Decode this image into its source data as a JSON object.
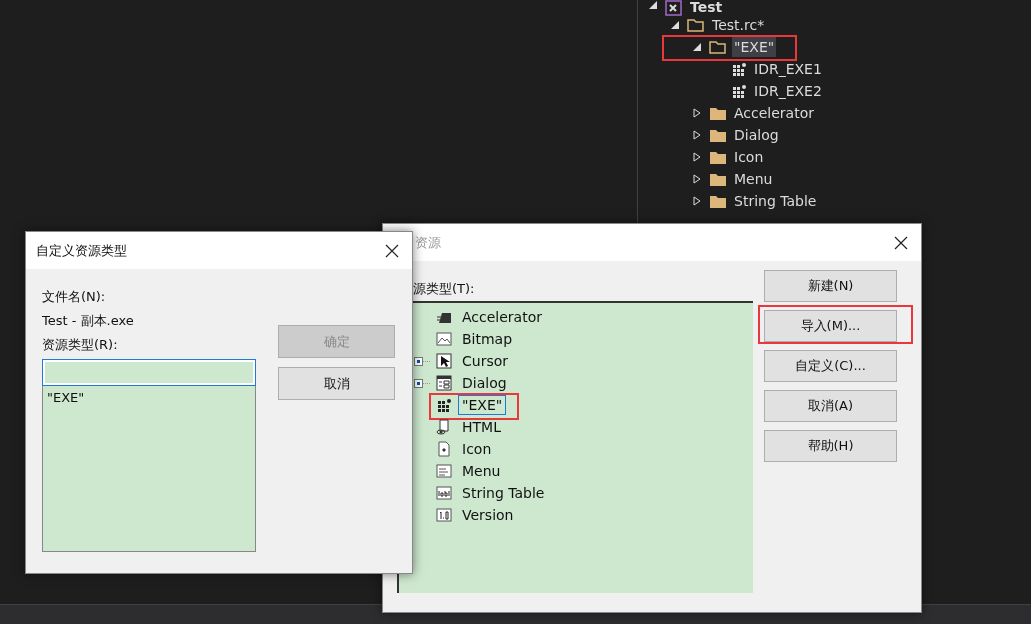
{
  "solution_tree": [
    {
      "label": "Test",
      "kind": "project",
      "expanded": true,
      "selected": false,
      "highlighted": false,
      "children": [
        {
          "label": "Test.rc*",
          "kind": "folder",
          "expanded": true,
          "selected": false,
          "highlighted": false,
          "children": [
            {
              "label": "\"EXE\"",
              "kind": "folder",
              "expanded": true,
              "selected": true,
              "highlighted": true,
              "children": [
                {
                  "label": "IDR_EXE1",
                  "kind": "resource",
                  "selected": false,
                  "highlighted": false
                },
                {
                  "label": "IDR_EXE2",
                  "kind": "resource",
                  "selected": false,
                  "highlighted": false
                }
              ]
            },
            {
              "label": "Accelerator",
              "kind": "folder",
              "expanded": false,
              "selected": false,
              "highlighted": false
            },
            {
              "label": "Dialog",
              "kind": "folder",
              "expanded": false,
              "selected": false,
              "highlighted": false
            },
            {
              "label": "Icon",
              "kind": "folder",
              "expanded": false,
              "selected": false,
              "highlighted": false
            },
            {
              "label": "Menu",
              "kind": "folder",
              "expanded": false,
              "selected": false,
              "highlighted": false
            },
            {
              "label": "String Table",
              "kind": "folder",
              "expanded": false,
              "selected": false,
              "highlighted": false
            }
          ]
        }
      ]
    }
  ],
  "add_resource_dialog": {
    "title": "资源",
    "list_label": "源类型(T):",
    "resource_types": [
      {
        "label": "Accelerator",
        "kind": "accelerator",
        "expandable": false,
        "selected": false,
        "highlighted": false
      },
      {
        "label": "Bitmap",
        "kind": "bitmap",
        "expandable": false,
        "selected": false,
        "highlighted": false
      },
      {
        "label": "Cursor",
        "kind": "cursor",
        "expandable": true,
        "selected": false,
        "highlighted": false
      },
      {
        "label": "Dialog",
        "kind": "dialog",
        "expandable": true,
        "selected": false,
        "highlighted": false
      },
      {
        "label": "\"EXE\"",
        "kind": "custom",
        "expandable": false,
        "selected": true,
        "highlighted": true
      },
      {
        "label": "HTML",
        "kind": "html",
        "expandable": false,
        "selected": false,
        "highlighted": false
      },
      {
        "label": "Icon",
        "kind": "icon",
        "expandable": false,
        "selected": false,
        "highlighted": false
      },
      {
        "label": "Menu",
        "kind": "menu",
        "expandable": false,
        "selected": false,
        "highlighted": false
      },
      {
        "label": "String Table",
        "kind": "string",
        "expandable": false,
        "selected": false,
        "highlighted": false
      },
      {
        "label": "Version",
        "kind": "version",
        "expandable": false,
        "selected": false,
        "highlighted": false
      }
    ],
    "buttons": [
      {
        "label": "新建(N)",
        "highlighted": false
      },
      {
        "label": "导入(M)...",
        "highlighted": true
      },
      {
        "label": "自定义(C)...",
        "highlighted": false
      },
      {
        "label": "取消(A)",
        "highlighted": false
      },
      {
        "label": "帮助(H)",
        "highlighted": false
      }
    ]
  },
  "custom_type_dialog": {
    "title": "自定义资源类型",
    "file_name_label": "文件名(N):",
    "file_name": "Test - 副本.exe",
    "type_label": "资源类型(R):",
    "types": [
      {
        "label": "\"EXE\"",
        "selected": false
      }
    ],
    "buttons": [
      {
        "label": "确定",
        "disabled": true
      },
      {
        "label": "取消",
        "disabled": false
      }
    ]
  }
}
